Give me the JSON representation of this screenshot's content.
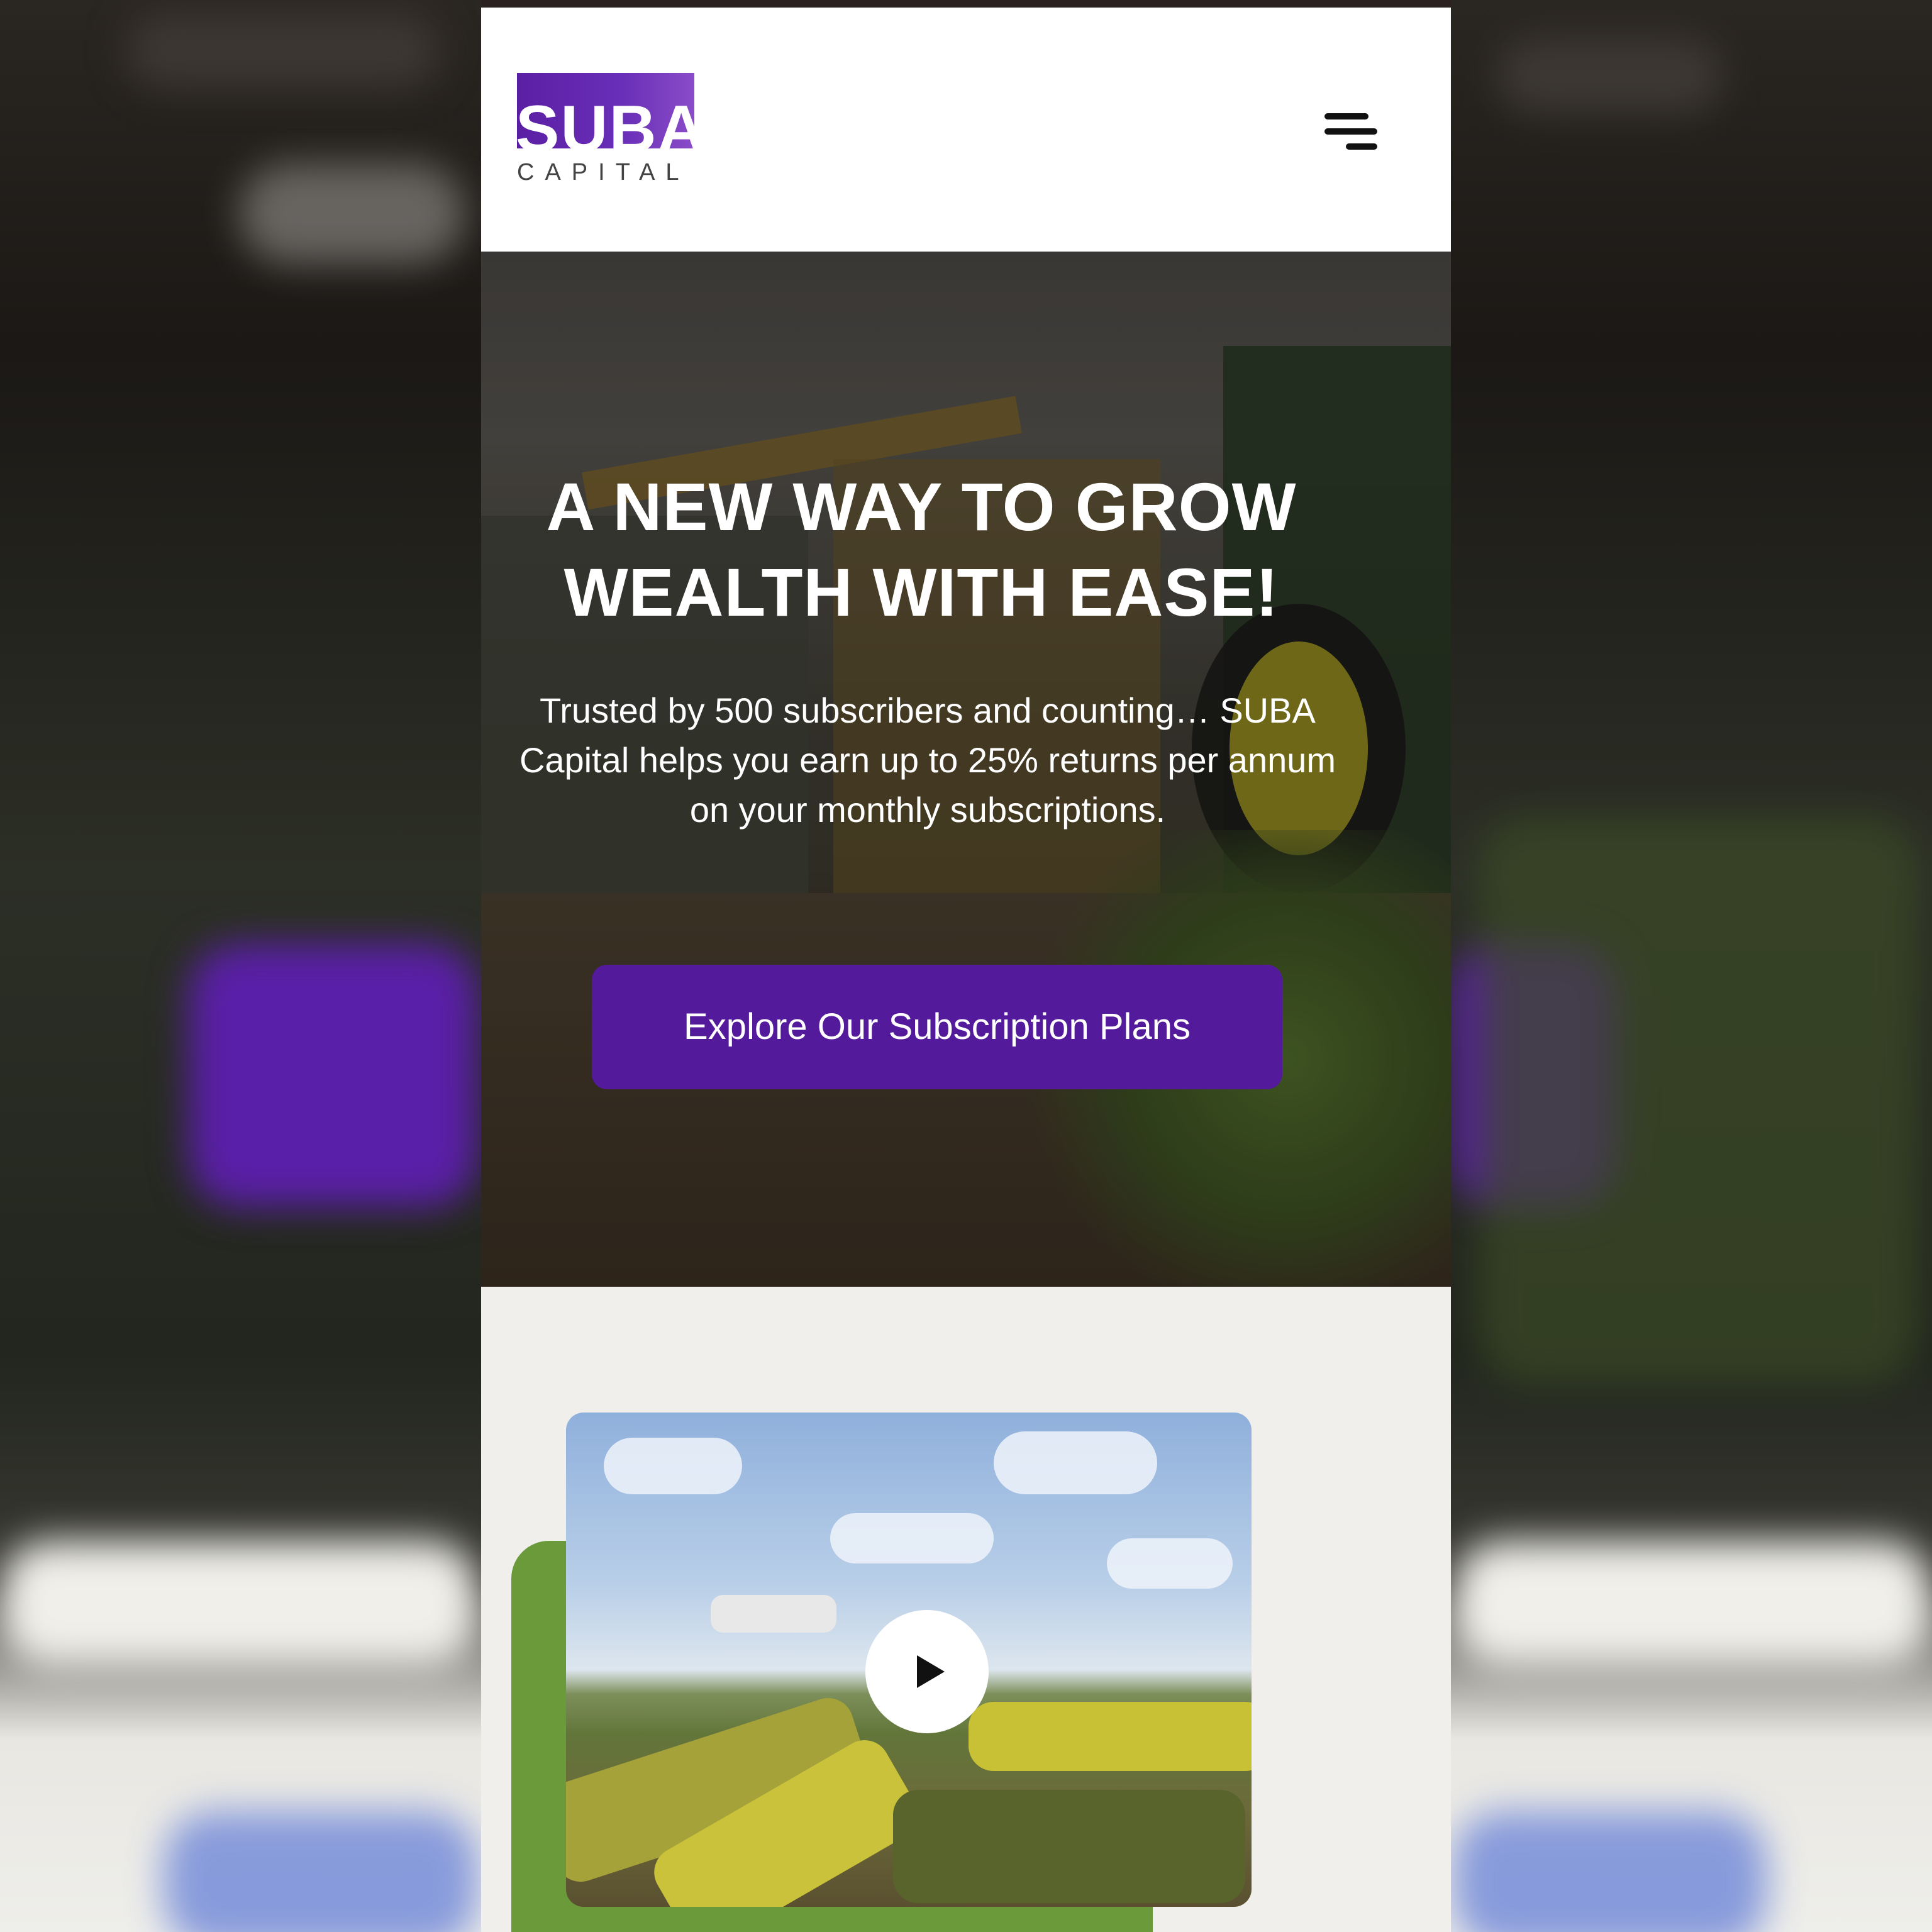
{
  "brand": {
    "logo_main": "SUBA",
    "logo_sub": "CAPITAL",
    "accent_color": "#531a9b",
    "green_color": "#6a9a3a"
  },
  "header": {
    "menu_icon": "hamburger-menu-icon"
  },
  "hero": {
    "title": "A NEW WAY TO GROW WEALTH WITH EASE!",
    "subtitle": "Trusted by 500 subscribers and counting… SUBA Capital helps you earn up to 25% returns per annum on your monthly subscriptions.",
    "cta_label": "Explore Our Subscription Plans"
  },
  "media": {
    "play_icon": "play-icon"
  }
}
